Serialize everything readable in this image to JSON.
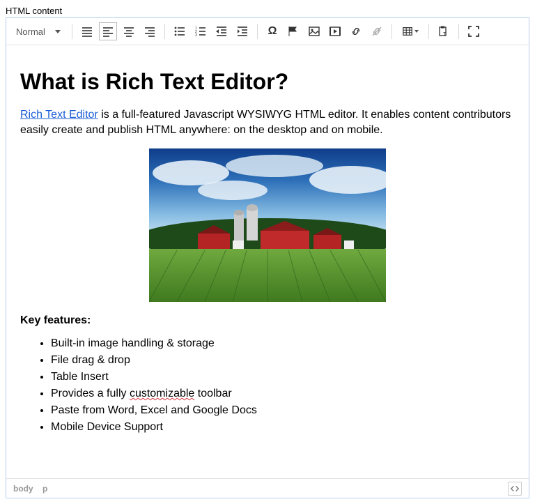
{
  "field_label": "HTML content",
  "toolbar": {
    "paragraph_style": "Normal"
  },
  "content": {
    "heading": "What is Rich Text Editor?",
    "intro": {
      "link_text": "Rich Text Editor",
      "rest": " is a full-featured Javascript WYSIWYG HTML editor. It enables content contributors easily create and publish HTML anywhere: on the desktop and on mobile."
    },
    "key_features_label": "Key features:",
    "features": [
      "Built-in image handling & storage",
      "File drag & drop",
      "Table Insert",
      {
        "prefix": "Provides a fully ",
        "spell": "customizable",
        "suffix": " toolbar"
      },
      "Paste from Word, Excel and Google Docs",
      "Mobile Device Support"
    ]
  },
  "statusbar": {
    "path": [
      "body",
      "p"
    ]
  }
}
